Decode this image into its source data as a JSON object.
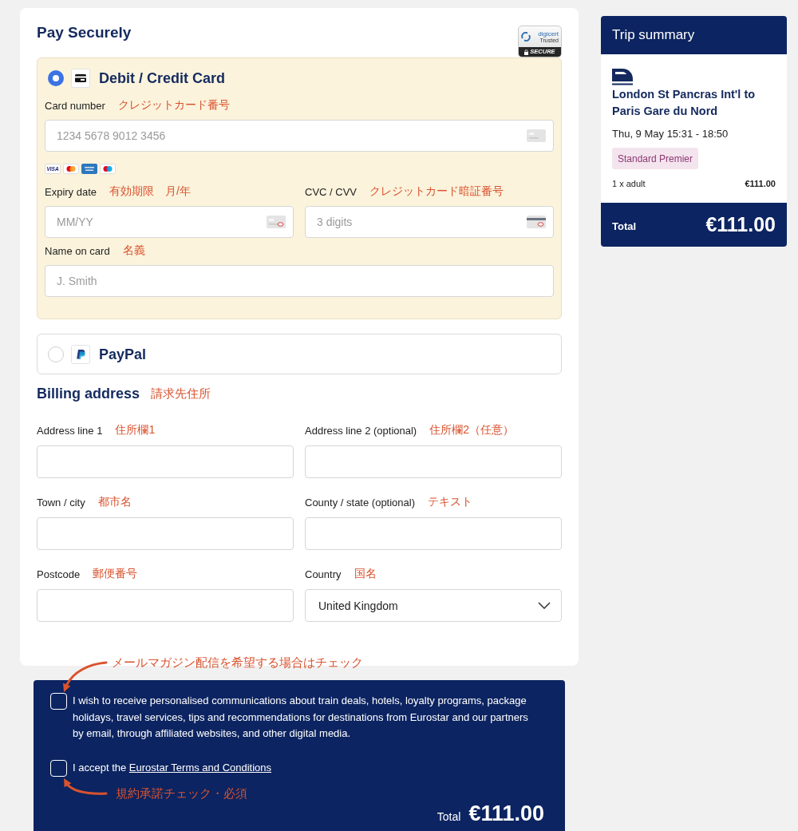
{
  "payment": {
    "title": "Pay Securely",
    "trust_badge": {
      "brand": "digicert",
      "caption": "Trusted",
      "seal": "SECURE"
    },
    "methods": [
      {
        "kind": "card",
        "label": "Debit / Credit Card",
        "selected": true,
        "rows": [
          [
            {
              "kind": "card_number",
              "label": "Card number",
              "note": "クレジットカード番号",
              "placeholder": "1234 5678 9012 3456",
              "accepted_cards": [
                {
                  "kind": "visa",
                  "text": "VISA"
                },
                {
                  "kind": "mastercard"
                },
                {
                  "kind": "amex"
                },
                {
                  "kind": "maestro"
                }
              ]
            }
          ],
          [
            {
              "kind": "expiry",
              "label": "Expiry date",
              "note": "有効期限　月/年",
              "placeholder": "MM/YY"
            },
            {
              "kind": "cvc",
              "label": "CVC / CVV",
              "note": "クレジットカード暗証番号",
              "placeholder": "3 digits"
            }
          ],
          [
            {
              "kind": "text",
              "label": "Name on card",
              "note": "名義",
              "placeholder": "J. Smith"
            }
          ]
        ]
      },
      {
        "kind": "paypal",
        "label": "PayPal",
        "selected": false
      }
    ]
  },
  "billing": {
    "title": "Billing address",
    "note": "請求先住所",
    "rows": [
      [
        {
          "kind": "text",
          "label": "Address line 1",
          "note": "住所欄1"
        },
        {
          "kind": "text",
          "label": "Address line 2 (optional)",
          "note": "住所欄2（任意）"
        }
      ],
      [
        {
          "kind": "text",
          "label": "Town / city",
          "note": "都市名"
        },
        {
          "kind": "text",
          "label": "County / state (optional)",
          "note": "テキスト"
        }
      ],
      [
        {
          "kind": "text",
          "label": "Postcode",
          "note": "郵便番号"
        },
        {
          "kind": "select",
          "label": "Country",
          "note": "国名",
          "value": "United Kingdom"
        }
      ]
    ]
  },
  "consent": {
    "options": [
      {
        "kind": "plain",
        "text": "I wish to receive personalised communications about train deals, hotels, loyalty programs, package holidays, travel services, tips and recommendations for destinations from Eurostar and our partners by email, through affiliated websites, and other digital media.",
        "checked": false,
        "annotation": "メールマガジン配信を希望する場合はチェック"
      },
      {
        "kind": "link",
        "text": "I accept the",
        "link": "Eurostar Terms and Conditions",
        "checked": false,
        "annotation": "規約承諾チェック・必須"
      }
    ],
    "total": {
      "label": "Total",
      "amount": "€111.00"
    }
  },
  "trip_summary": {
    "title": "Trip summary",
    "route": "London St Pancras Int'l to Paris Gare du Nord",
    "time": "Thu, 9 May 15:31 - 18:50",
    "fare_class": "Standard Premier",
    "passengers": "1 x adult",
    "price": "€111.00",
    "total": {
      "label": "Total",
      "amount": "€111.00"
    }
  }
}
